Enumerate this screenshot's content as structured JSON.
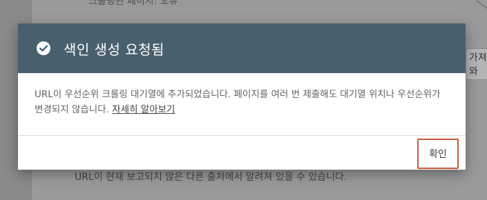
{
  "background": {
    "top_text": "크롤링된 페이지: 오류",
    "right_fragment": "가져와",
    "bottom_text": "URL이 현재 보고되지 않은 다른 출처에서 알려져 있을 수 있습니다."
  },
  "dialog": {
    "icon": "check-circle-icon",
    "title": "색인 생성 요청됨",
    "body_text": "URL이 우선순위 크롤링 대기열에 추가되었습니다. 페이지를 여러 번 제출해도 대기열 위치나 우선순위가 변경되지 않습니다. ",
    "link_text": "자세히 알아보기",
    "ok_label": "확인"
  },
  "colors": {
    "header_bg": "#48606e",
    "ok_border": "#c8573a",
    "overlay": "#8a8a8a"
  }
}
